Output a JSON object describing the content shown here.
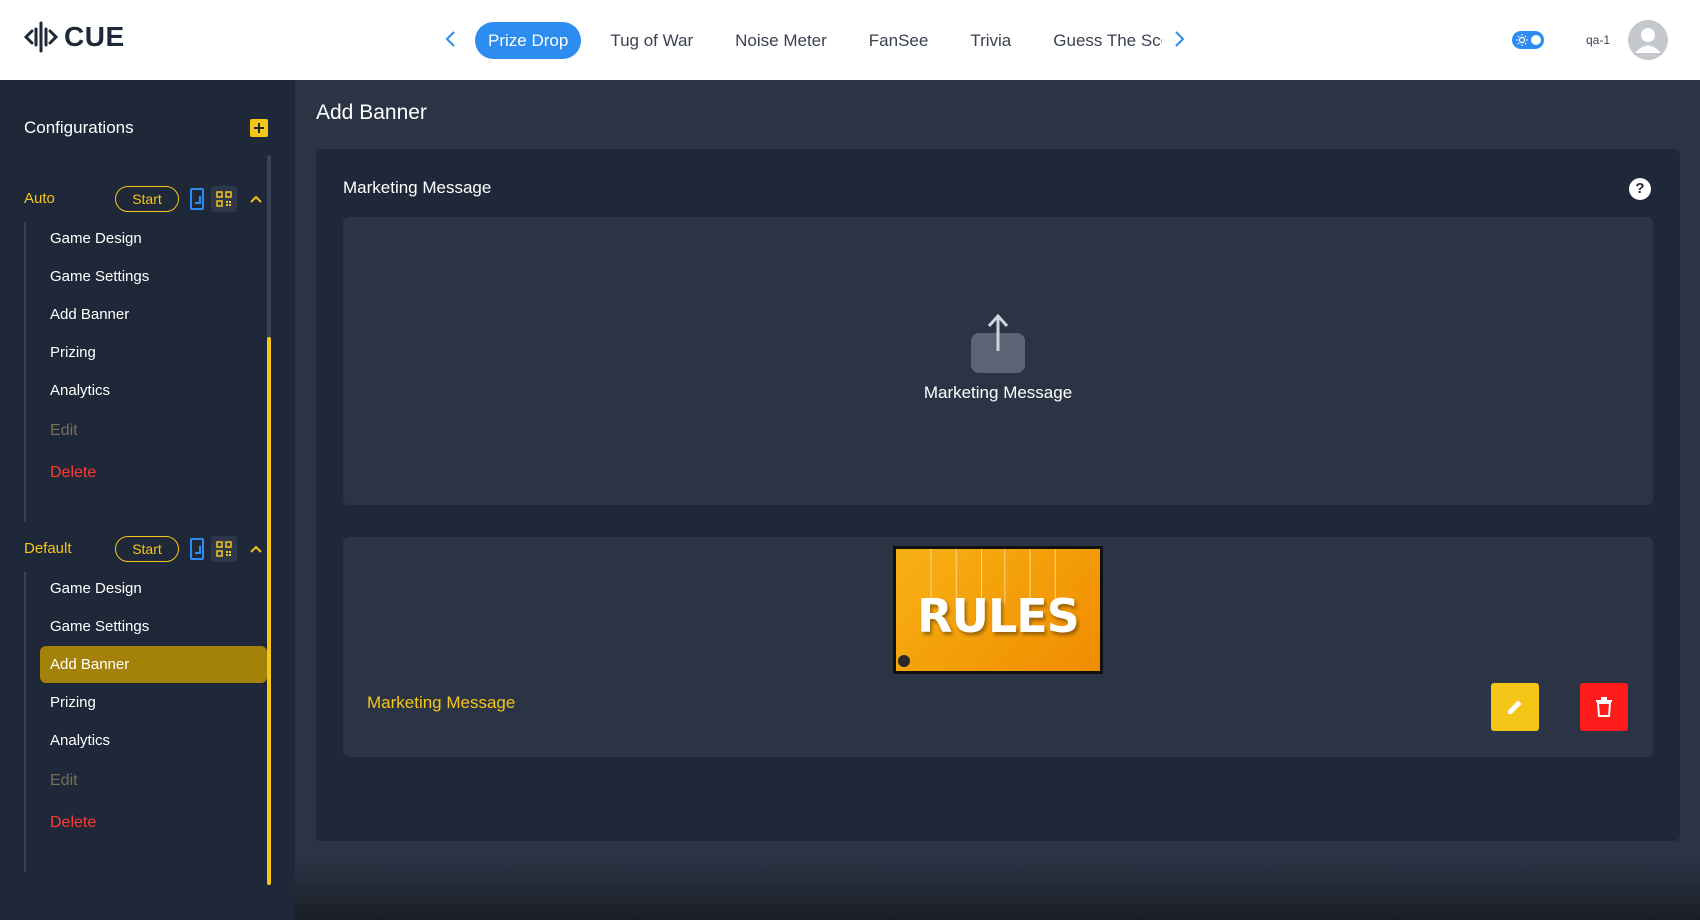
{
  "app": {
    "logo_text": "CUE"
  },
  "header": {
    "tabs": [
      {
        "label": "Prize Drop",
        "active": true
      },
      {
        "label": "Tug of War",
        "active": false
      },
      {
        "label": "Noise Meter",
        "active": false
      },
      {
        "label": "FanSee",
        "active": false
      },
      {
        "label": "Trivia",
        "active": false
      },
      {
        "label": "Guess The Score",
        "active": false
      }
    ],
    "user_name": "qa-1",
    "theme_toggle": "on"
  },
  "sidebar": {
    "title": "Configurations",
    "groups": [
      {
        "name": "Auto",
        "start_label": "Start",
        "items": [
          "Game Design",
          "Game Settings",
          "Add Banner",
          "Prizing",
          "Analytics"
        ],
        "edit_label": "Edit",
        "delete_label": "Delete"
      },
      {
        "name": "Default",
        "start_label": "Start",
        "items": [
          "Game Design",
          "Game Settings",
          "Add Banner",
          "Prizing",
          "Analytics"
        ],
        "edit_label": "Edit",
        "delete_label": "Delete",
        "active_item": "Add Banner"
      }
    ]
  },
  "main": {
    "title": "Add Banner",
    "section_label": "Marketing Message",
    "help": "?",
    "dropzone_label": "Marketing Message",
    "banner": {
      "image_text": "RULES",
      "label": "Marketing Message"
    }
  },
  "colors": {
    "accent": "#f5c518",
    "primary": "#2d8cf0",
    "danger": "#ff1c1c",
    "sidebar_bg": "#1f2838",
    "main_bg": "#2b3445"
  }
}
